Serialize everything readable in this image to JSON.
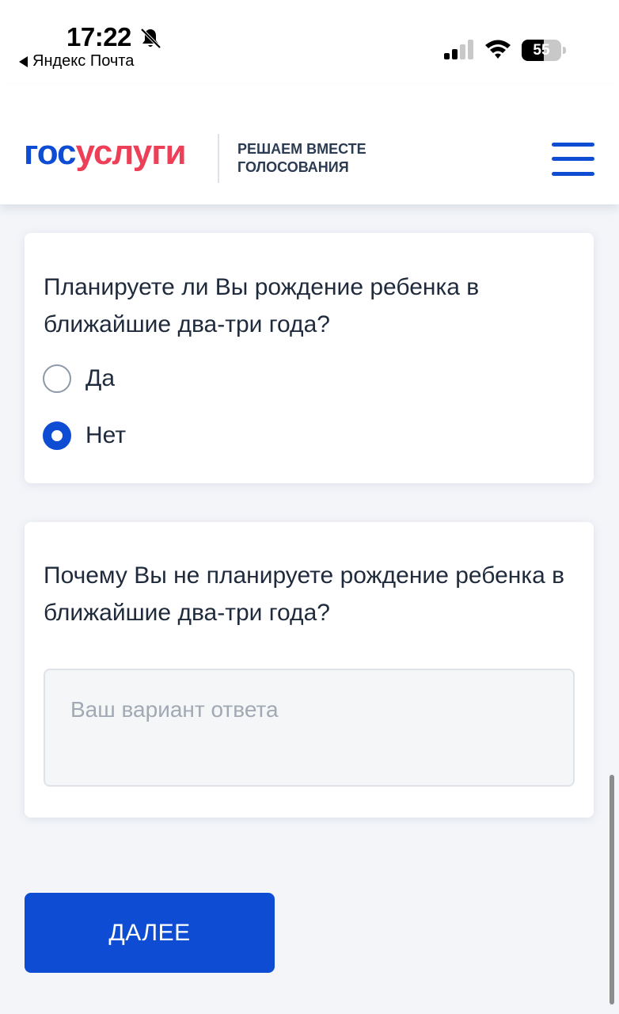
{
  "status_bar": {
    "time": "17:22",
    "back_app": "Яндекс Почта",
    "battery": "55",
    "battery_level": 0.55
  },
  "header": {
    "logo_part1": "гос",
    "logo_part2": "услуги",
    "tagline_line1": "РЕШАЕМ ВМЕСТЕ",
    "tagline_line2": "ГОЛОСОВАНИЯ"
  },
  "question1": {
    "text": "Планируете ли Вы рождение ребенка в ближайшие два-три года?",
    "options": [
      {
        "label": "Да",
        "checked": false
      },
      {
        "label": "Нет",
        "checked": true
      }
    ]
  },
  "question2": {
    "text": "Почему Вы не планируете рождение ребенка в ближайшие два-три года?",
    "placeholder": "Ваш вариант ответа",
    "value": ""
  },
  "next_button": "ДАЛЕЕ",
  "colors": {
    "primary": "#0d4cd3",
    "logo_red": "#ee3f58",
    "background": "#f3f5f9"
  }
}
